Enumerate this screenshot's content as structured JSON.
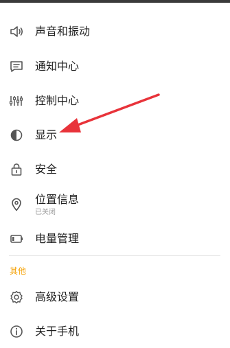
{
  "settings": {
    "items": [
      {
        "label": "声音和振动",
        "icon": "speaker-icon"
      },
      {
        "label": "通知中心",
        "icon": "message-icon"
      },
      {
        "label": "控制中心",
        "icon": "sliders-icon"
      },
      {
        "label": "显示",
        "icon": "contrast-icon"
      },
      {
        "label": "安全",
        "icon": "lock-icon"
      },
      {
        "label": "位置信息",
        "sublabel": "已关闭",
        "icon": "location-pin-icon"
      },
      {
        "label": "电量管理",
        "icon": "battery-icon"
      }
    ],
    "other_section": {
      "header": "其他",
      "items": [
        {
          "label": "高级设置",
          "icon": "gear-icon"
        },
        {
          "label": "关于手机",
          "icon": "info-icon"
        }
      ]
    }
  },
  "colors": {
    "text": "#1f1f1f",
    "icon": "#555555",
    "section_header": "#f5a000",
    "annotation_arrow": "#e8333a",
    "sublabel": "#9a9a9a"
  },
  "annotation": {
    "type": "arrow",
    "points_to": "显示"
  }
}
